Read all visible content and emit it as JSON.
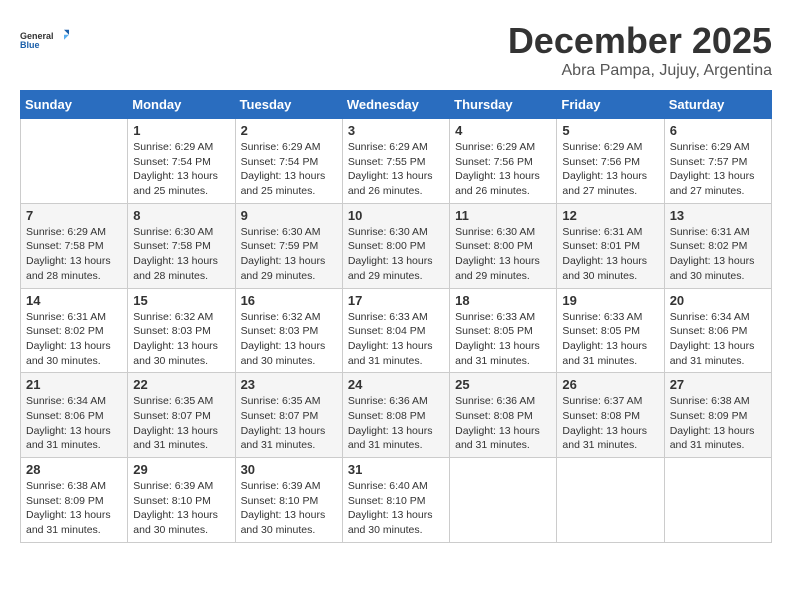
{
  "logo": {
    "general": "General",
    "blue": "Blue"
  },
  "title": "December 2025",
  "subtitle": "Abra Pampa, Jujuy, Argentina",
  "headers": [
    "Sunday",
    "Monday",
    "Tuesday",
    "Wednesday",
    "Thursday",
    "Friday",
    "Saturday"
  ],
  "weeks": [
    [
      {
        "day": "",
        "info": ""
      },
      {
        "day": "1",
        "info": "Sunrise: 6:29 AM\nSunset: 7:54 PM\nDaylight: 13 hours\nand 25 minutes."
      },
      {
        "day": "2",
        "info": "Sunrise: 6:29 AM\nSunset: 7:54 PM\nDaylight: 13 hours\nand 25 minutes."
      },
      {
        "day": "3",
        "info": "Sunrise: 6:29 AM\nSunset: 7:55 PM\nDaylight: 13 hours\nand 26 minutes."
      },
      {
        "day": "4",
        "info": "Sunrise: 6:29 AM\nSunset: 7:56 PM\nDaylight: 13 hours\nand 26 minutes."
      },
      {
        "day": "5",
        "info": "Sunrise: 6:29 AM\nSunset: 7:56 PM\nDaylight: 13 hours\nand 27 minutes."
      },
      {
        "day": "6",
        "info": "Sunrise: 6:29 AM\nSunset: 7:57 PM\nDaylight: 13 hours\nand 27 minutes."
      }
    ],
    [
      {
        "day": "7",
        "info": "Sunrise: 6:29 AM\nSunset: 7:58 PM\nDaylight: 13 hours\nand 28 minutes."
      },
      {
        "day": "8",
        "info": "Sunrise: 6:30 AM\nSunset: 7:58 PM\nDaylight: 13 hours\nand 28 minutes."
      },
      {
        "day": "9",
        "info": "Sunrise: 6:30 AM\nSunset: 7:59 PM\nDaylight: 13 hours\nand 29 minutes."
      },
      {
        "day": "10",
        "info": "Sunrise: 6:30 AM\nSunset: 8:00 PM\nDaylight: 13 hours\nand 29 minutes."
      },
      {
        "day": "11",
        "info": "Sunrise: 6:30 AM\nSunset: 8:00 PM\nDaylight: 13 hours\nand 29 minutes."
      },
      {
        "day": "12",
        "info": "Sunrise: 6:31 AM\nSunset: 8:01 PM\nDaylight: 13 hours\nand 30 minutes."
      },
      {
        "day": "13",
        "info": "Sunrise: 6:31 AM\nSunset: 8:02 PM\nDaylight: 13 hours\nand 30 minutes."
      }
    ],
    [
      {
        "day": "14",
        "info": "Sunrise: 6:31 AM\nSunset: 8:02 PM\nDaylight: 13 hours\nand 30 minutes."
      },
      {
        "day": "15",
        "info": "Sunrise: 6:32 AM\nSunset: 8:03 PM\nDaylight: 13 hours\nand 30 minutes."
      },
      {
        "day": "16",
        "info": "Sunrise: 6:32 AM\nSunset: 8:03 PM\nDaylight: 13 hours\nand 30 minutes."
      },
      {
        "day": "17",
        "info": "Sunrise: 6:33 AM\nSunset: 8:04 PM\nDaylight: 13 hours\nand 31 minutes."
      },
      {
        "day": "18",
        "info": "Sunrise: 6:33 AM\nSunset: 8:05 PM\nDaylight: 13 hours\nand 31 minutes."
      },
      {
        "day": "19",
        "info": "Sunrise: 6:33 AM\nSunset: 8:05 PM\nDaylight: 13 hours\nand 31 minutes."
      },
      {
        "day": "20",
        "info": "Sunrise: 6:34 AM\nSunset: 8:06 PM\nDaylight: 13 hours\nand 31 minutes."
      }
    ],
    [
      {
        "day": "21",
        "info": "Sunrise: 6:34 AM\nSunset: 8:06 PM\nDaylight: 13 hours\nand 31 minutes."
      },
      {
        "day": "22",
        "info": "Sunrise: 6:35 AM\nSunset: 8:07 PM\nDaylight: 13 hours\nand 31 minutes."
      },
      {
        "day": "23",
        "info": "Sunrise: 6:35 AM\nSunset: 8:07 PM\nDaylight: 13 hours\nand 31 minutes."
      },
      {
        "day": "24",
        "info": "Sunrise: 6:36 AM\nSunset: 8:08 PM\nDaylight: 13 hours\nand 31 minutes."
      },
      {
        "day": "25",
        "info": "Sunrise: 6:36 AM\nSunset: 8:08 PM\nDaylight: 13 hours\nand 31 minutes."
      },
      {
        "day": "26",
        "info": "Sunrise: 6:37 AM\nSunset: 8:08 PM\nDaylight: 13 hours\nand 31 minutes."
      },
      {
        "day": "27",
        "info": "Sunrise: 6:38 AM\nSunset: 8:09 PM\nDaylight: 13 hours\nand 31 minutes."
      }
    ],
    [
      {
        "day": "28",
        "info": "Sunrise: 6:38 AM\nSunset: 8:09 PM\nDaylight: 13 hours\nand 31 minutes."
      },
      {
        "day": "29",
        "info": "Sunrise: 6:39 AM\nSunset: 8:10 PM\nDaylight: 13 hours\nand 30 minutes."
      },
      {
        "day": "30",
        "info": "Sunrise: 6:39 AM\nSunset: 8:10 PM\nDaylight: 13 hours\nand 30 minutes."
      },
      {
        "day": "31",
        "info": "Sunrise: 6:40 AM\nSunset: 8:10 PM\nDaylight: 13 hours\nand 30 minutes."
      },
      {
        "day": "",
        "info": ""
      },
      {
        "day": "",
        "info": ""
      },
      {
        "day": "",
        "info": ""
      }
    ]
  ]
}
